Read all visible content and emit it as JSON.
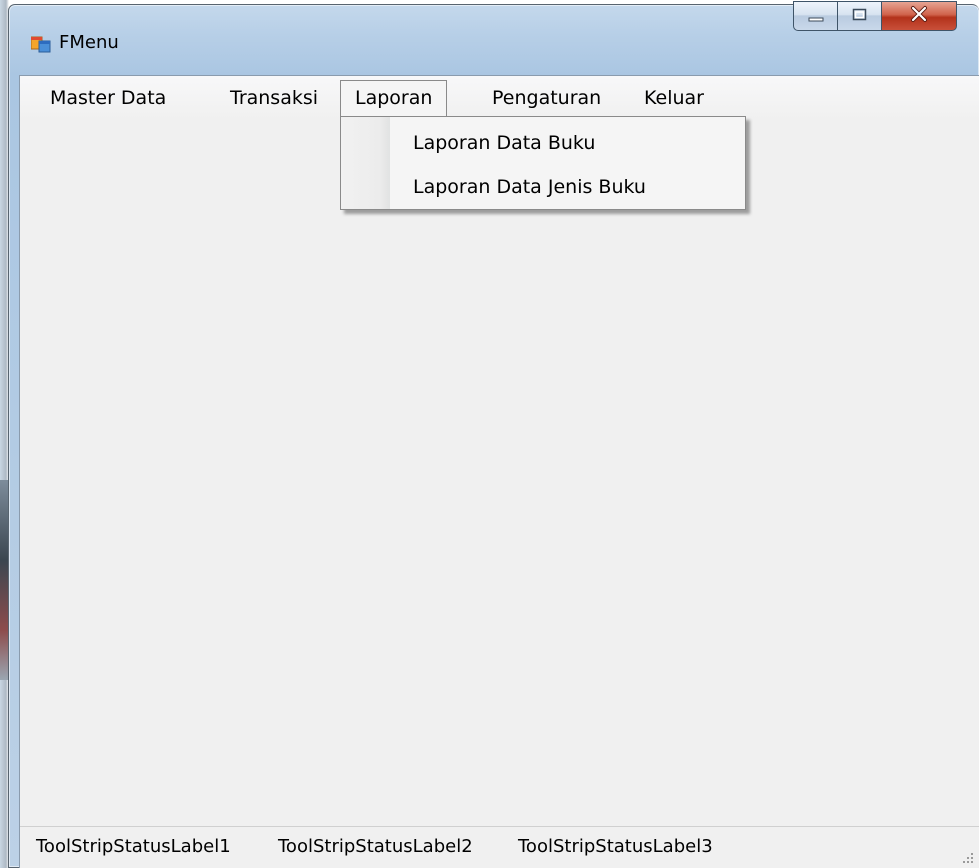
{
  "window": {
    "title": "FMenu",
    "icon": "app-form-icon",
    "controls": [
      "minimize-icon",
      "maximize-icon",
      "close-icon"
    ]
  },
  "menubar": {
    "items": [
      {
        "label": "Master Data"
      },
      {
        "label": "Transaksi"
      },
      {
        "label": "Laporan",
        "open": true
      },
      {
        "label": "Pengaturan"
      },
      {
        "label": "Keluar"
      }
    ]
  },
  "dropdown": {
    "items": [
      {
        "label": "Laporan Data Buku"
      },
      {
        "label": "Laporan Data Jenis Buku"
      }
    ]
  },
  "statusbar": {
    "labels": [
      {
        "text": "ToolStripStatusLabel1"
      },
      {
        "text": "ToolStripStatusLabel2"
      },
      {
        "text": "ToolStripStatusLabel3"
      }
    ],
    "grip_icon": "size-grip-icon"
  },
  "colors": {
    "client_background": "#f0f0f0",
    "close_button": "#c9503a",
    "frame": "#b7cfe7"
  }
}
